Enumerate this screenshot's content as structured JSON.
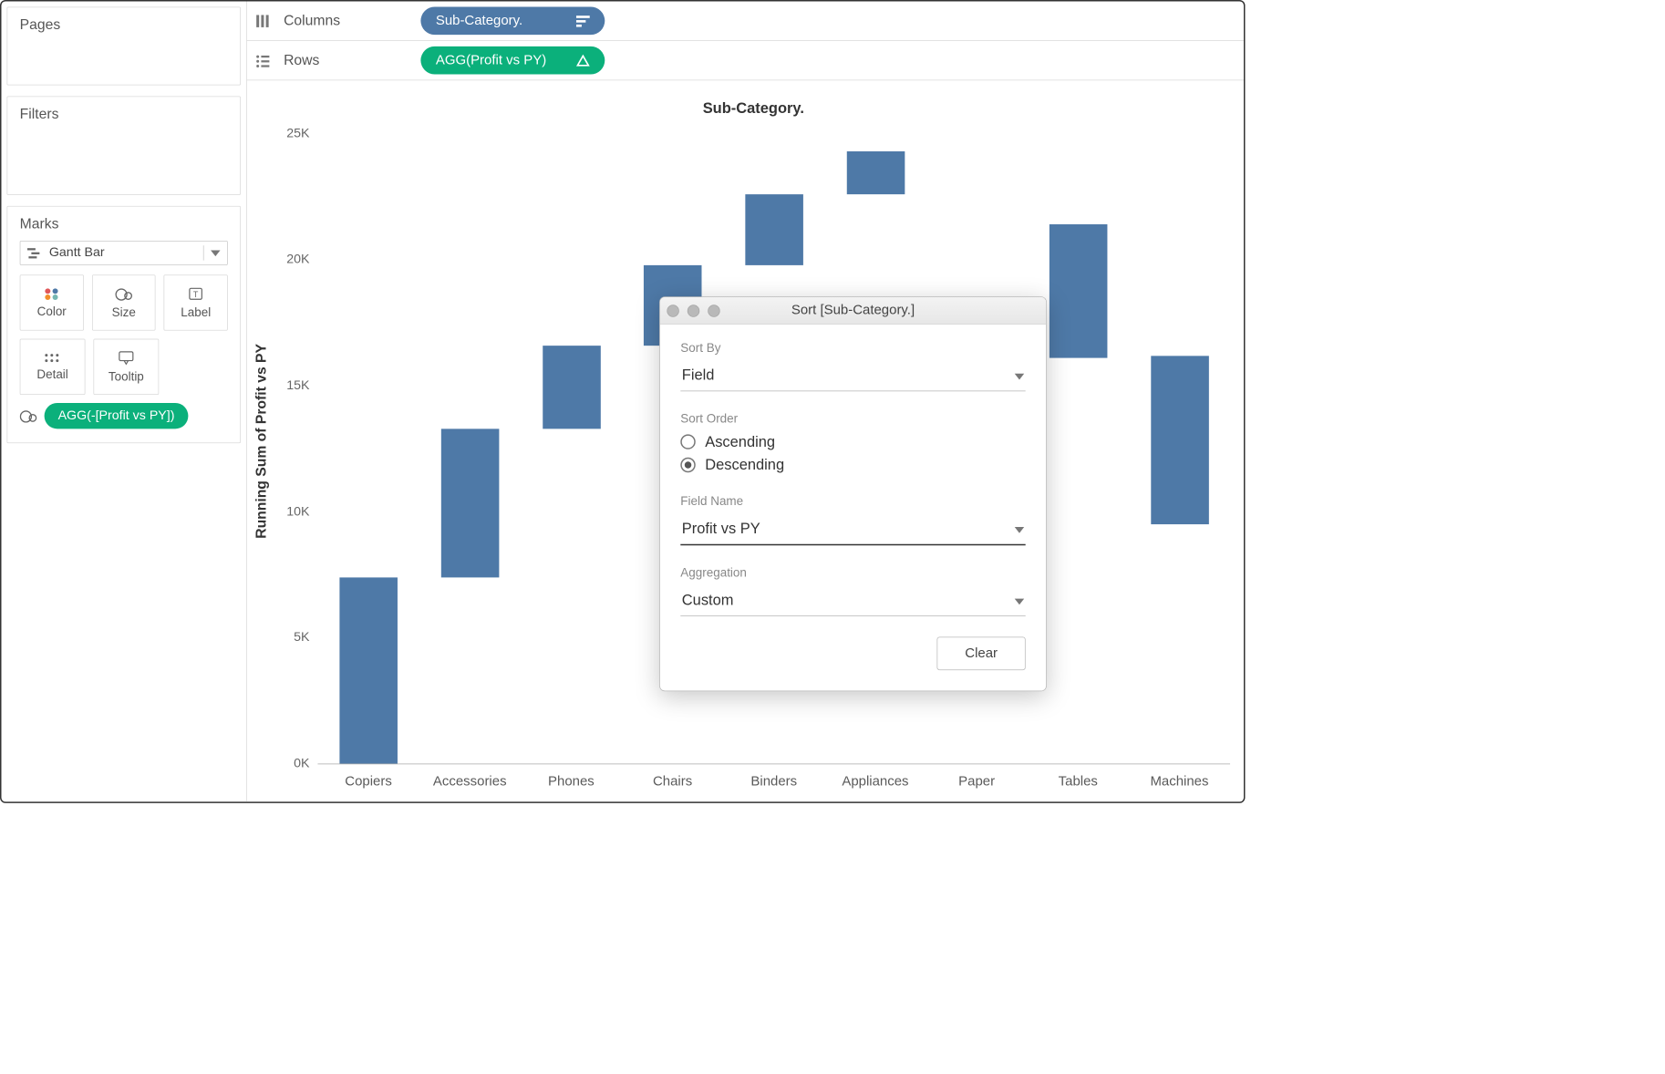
{
  "left": {
    "pages_label": "Pages",
    "filters_label": "Filters",
    "marks_label": "Marks",
    "mark_type": "Gantt Bar",
    "mark_cards": {
      "color": "Color",
      "size": "Size",
      "label": "Label",
      "detail": "Detail",
      "tooltip": "Tooltip"
    },
    "size_pill": "AGG(-[Profit vs PY])"
  },
  "shelves": {
    "columns_label": "Columns",
    "columns_pill": "Sub-Category.",
    "rows_label": "Rows",
    "rows_pill": "AGG(Profit vs PY)"
  },
  "chart_data": {
    "type": "bar",
    "title": "Sub-Category.",
    "ylabel": "Running Sum of Profit vs PY",
    "categories": [
      "Copiers",
      "Accessories",
      "Phones",
      "Chairs",
      "Binders",
      "Appliances",
      "Paper",
      "Tables",
      "Machines"
    ],
    "bars": [
      {
        "bottom": 0.0,
        "top": 7.4
      },
      {
        "bottom": 7.4,
        "top": 13.3
      },
      {
        "bottom": 13.3,
        "top": 16.6
      },
      {
        "bottom": 16.6,
        "top": 19.8
      },
      {
        "bottom": 19.8,
        "top": 22.6
      },
      {
        "bottom": 22.6,
        "top": 24.3
      },
      {
        "bottom": 24.3,
        "top": 24.3
      },
      {
        "bottom": 16.1,
        "top": 21.4
      },
      {
        "bottom": 9.5,
        "top": 16.2
      }
    ],
    "yticks": [
      0,
      5,
      10,
      15,
      20,
      25
    ],
    "ytick_labels": [
      "0K",
      "5K",
      "10K",
      "15K",
      "20K",
      "25K"
    ],
    "ylim": [
      0,
      25.5
    ]
  },
  "dialog": {
    "title": "Sort [Sub-Category.]",
    "sort_by_label": "Sort By",
    "sort_by_value": "Field",
    "sort_order_label": "Sort Order",
    "order_asc": "Ascending",
    "order_desc": "Descending",
    "order_selected": "Descending",
    "field_name_label": "Field Name",
    "field_name_value": "Profit vs PY",
    "aggregation_label": "Aggregation",
    "aggregation_value": "Custom",
    "clear_label": "Clear"
  }
}
